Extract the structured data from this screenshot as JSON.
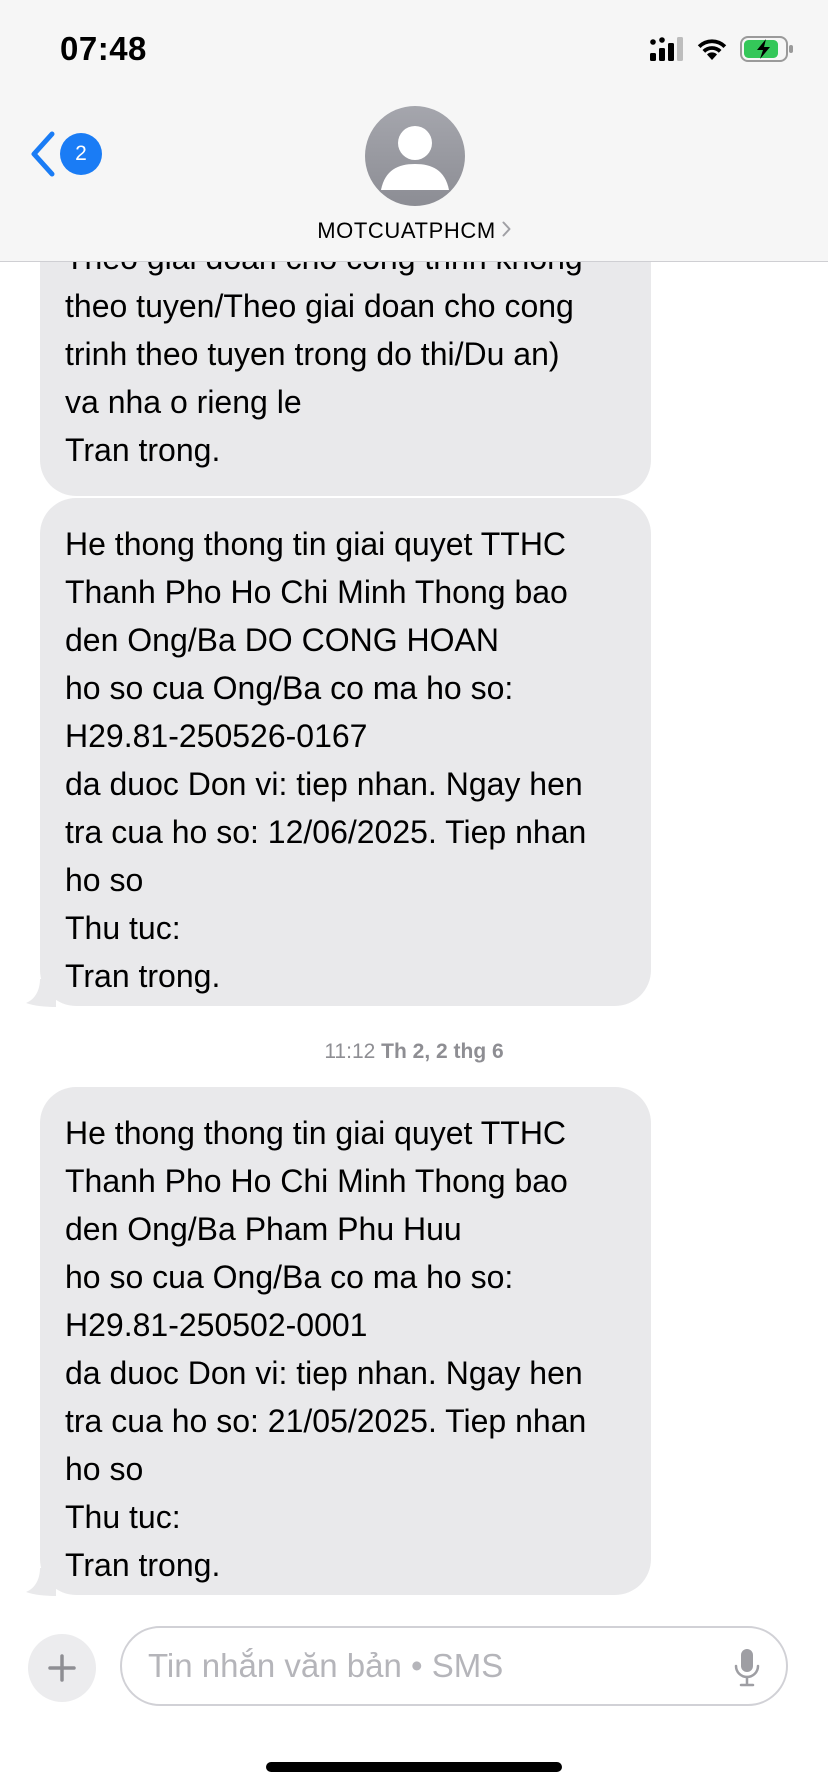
{
  "status_bar": {
    "time": "07:48"
  },
  "header": {
    "back_badge": "2",
    "contact_name": "MOTCUATPHCM"
  },
  "messages": [
    {
      "text": "Theo giai doan cho cong trinh khong\ntheo tuyen/Theo giai doan cho cong\ntrinh theo tuyen trong do thi/Du an)\nva nha o rieng le\nTran trong."
    },
    {
      "text": "He thong thong tin giai quyet TTHC\nThanh Pho Ho Chi Minh Thong bao\nden Ong/Ba DO CONG HOAN\nho so cua Ong/Ba co ma ho so:\nH29.81-250526-0167\nda duoc Don vi:  tiep nhan. Ngay hen\ntra cua ho so: 12/06/2025. Tiep nhan\nho so\nThu tuc:\nTran trong."
    },
    {
      "text": "He thong thong tin giai quyet TTHC\nThanh Pho Ho Chi Minh Thong bao\nden Ong/Ba Pham Phu Huu\nho so cua Ong/Ba co ma ho so:\nH29.81-250502-0001\nda duoc Don vi:  tiep nhan. Ngay hen\ntra cua ho so: 21/05/2025. Tiep nhan\nho so\nThu tuc:\nTran trong."
    }
  ],
  "timestamp": {
    "time": "11:12",
    "date": "Th 2, 2 thg 6"
  },
  "composer": {
    "placeholder": "Tin nhắn văn bản • SMS"
  },
  "colors": {
    "accent": "#1a7cf5",
    "bubble": "#e9e9eb",
    "battery": "#34c759"
  }
}
